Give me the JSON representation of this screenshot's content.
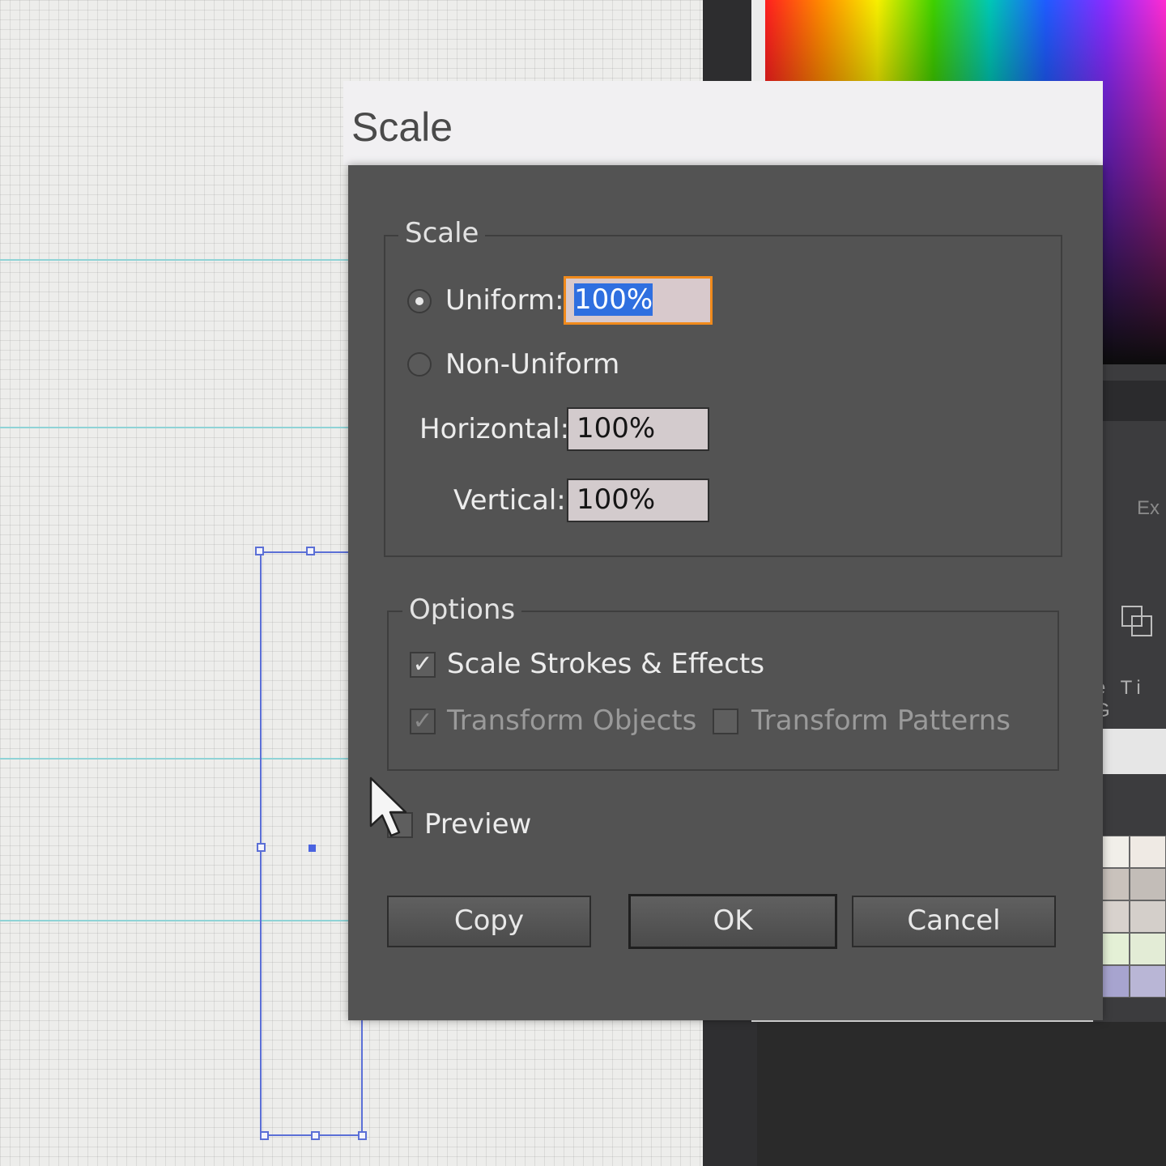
{
  "dialog": {
    "title": "Scale",
    "scale_group": {
      "legend": "Scale",
      "uniform_label": "Uniform:",
      "uniform_value": "100%",
      "uniform_selected": true,
      "non_uniform_label": "Non-Uniform",
      "non_uniform_selected": false,
      "horizontal_label": "Horizontal:",
      "horizontal_value": "100%",
      "vertical_label": "Vertical:",
      "vertical_value": "100%"
    },
    "options_group": {
      "legend": "Options",
      "scale_strokes_label": "Scale Strokes & Effects",
      "scale_strokes_checked": true,
      "transform_objects_label": "Transform Objects",
      "transform_objects_checked": true,
      "transform_patterns_label": "Transform Patterns",
      "transform_patterns_checked": false
    },
    "preview_label": "Preview",
    "preview_checked": false,
    "buttons": {
      "copy": "Copy",
      "ok": "OK",
      "cancel": "Cancel"
    }
  },
  "right_panel": {
    "partial_label": "Ex",
    "tabs_partial": "e Ti  G"
  },
  "colors": {
    "dialog_bg": "#535353",
    "title_bar_bg": "#f1f0f2",
    "focus_ring": "#f08a1c",
    "text_selection": "#2f6fe0",
    "selection_blue": "#5b6fd6",
    "guide_cyan": "#8fd3d6"
  },
  "icons": {
    "radio_on": "radio-selected",
    "check": "checkmark",
    "cursor": "arrow-pointer",
    "panel_icon": "arrange-icon"
  }
}
